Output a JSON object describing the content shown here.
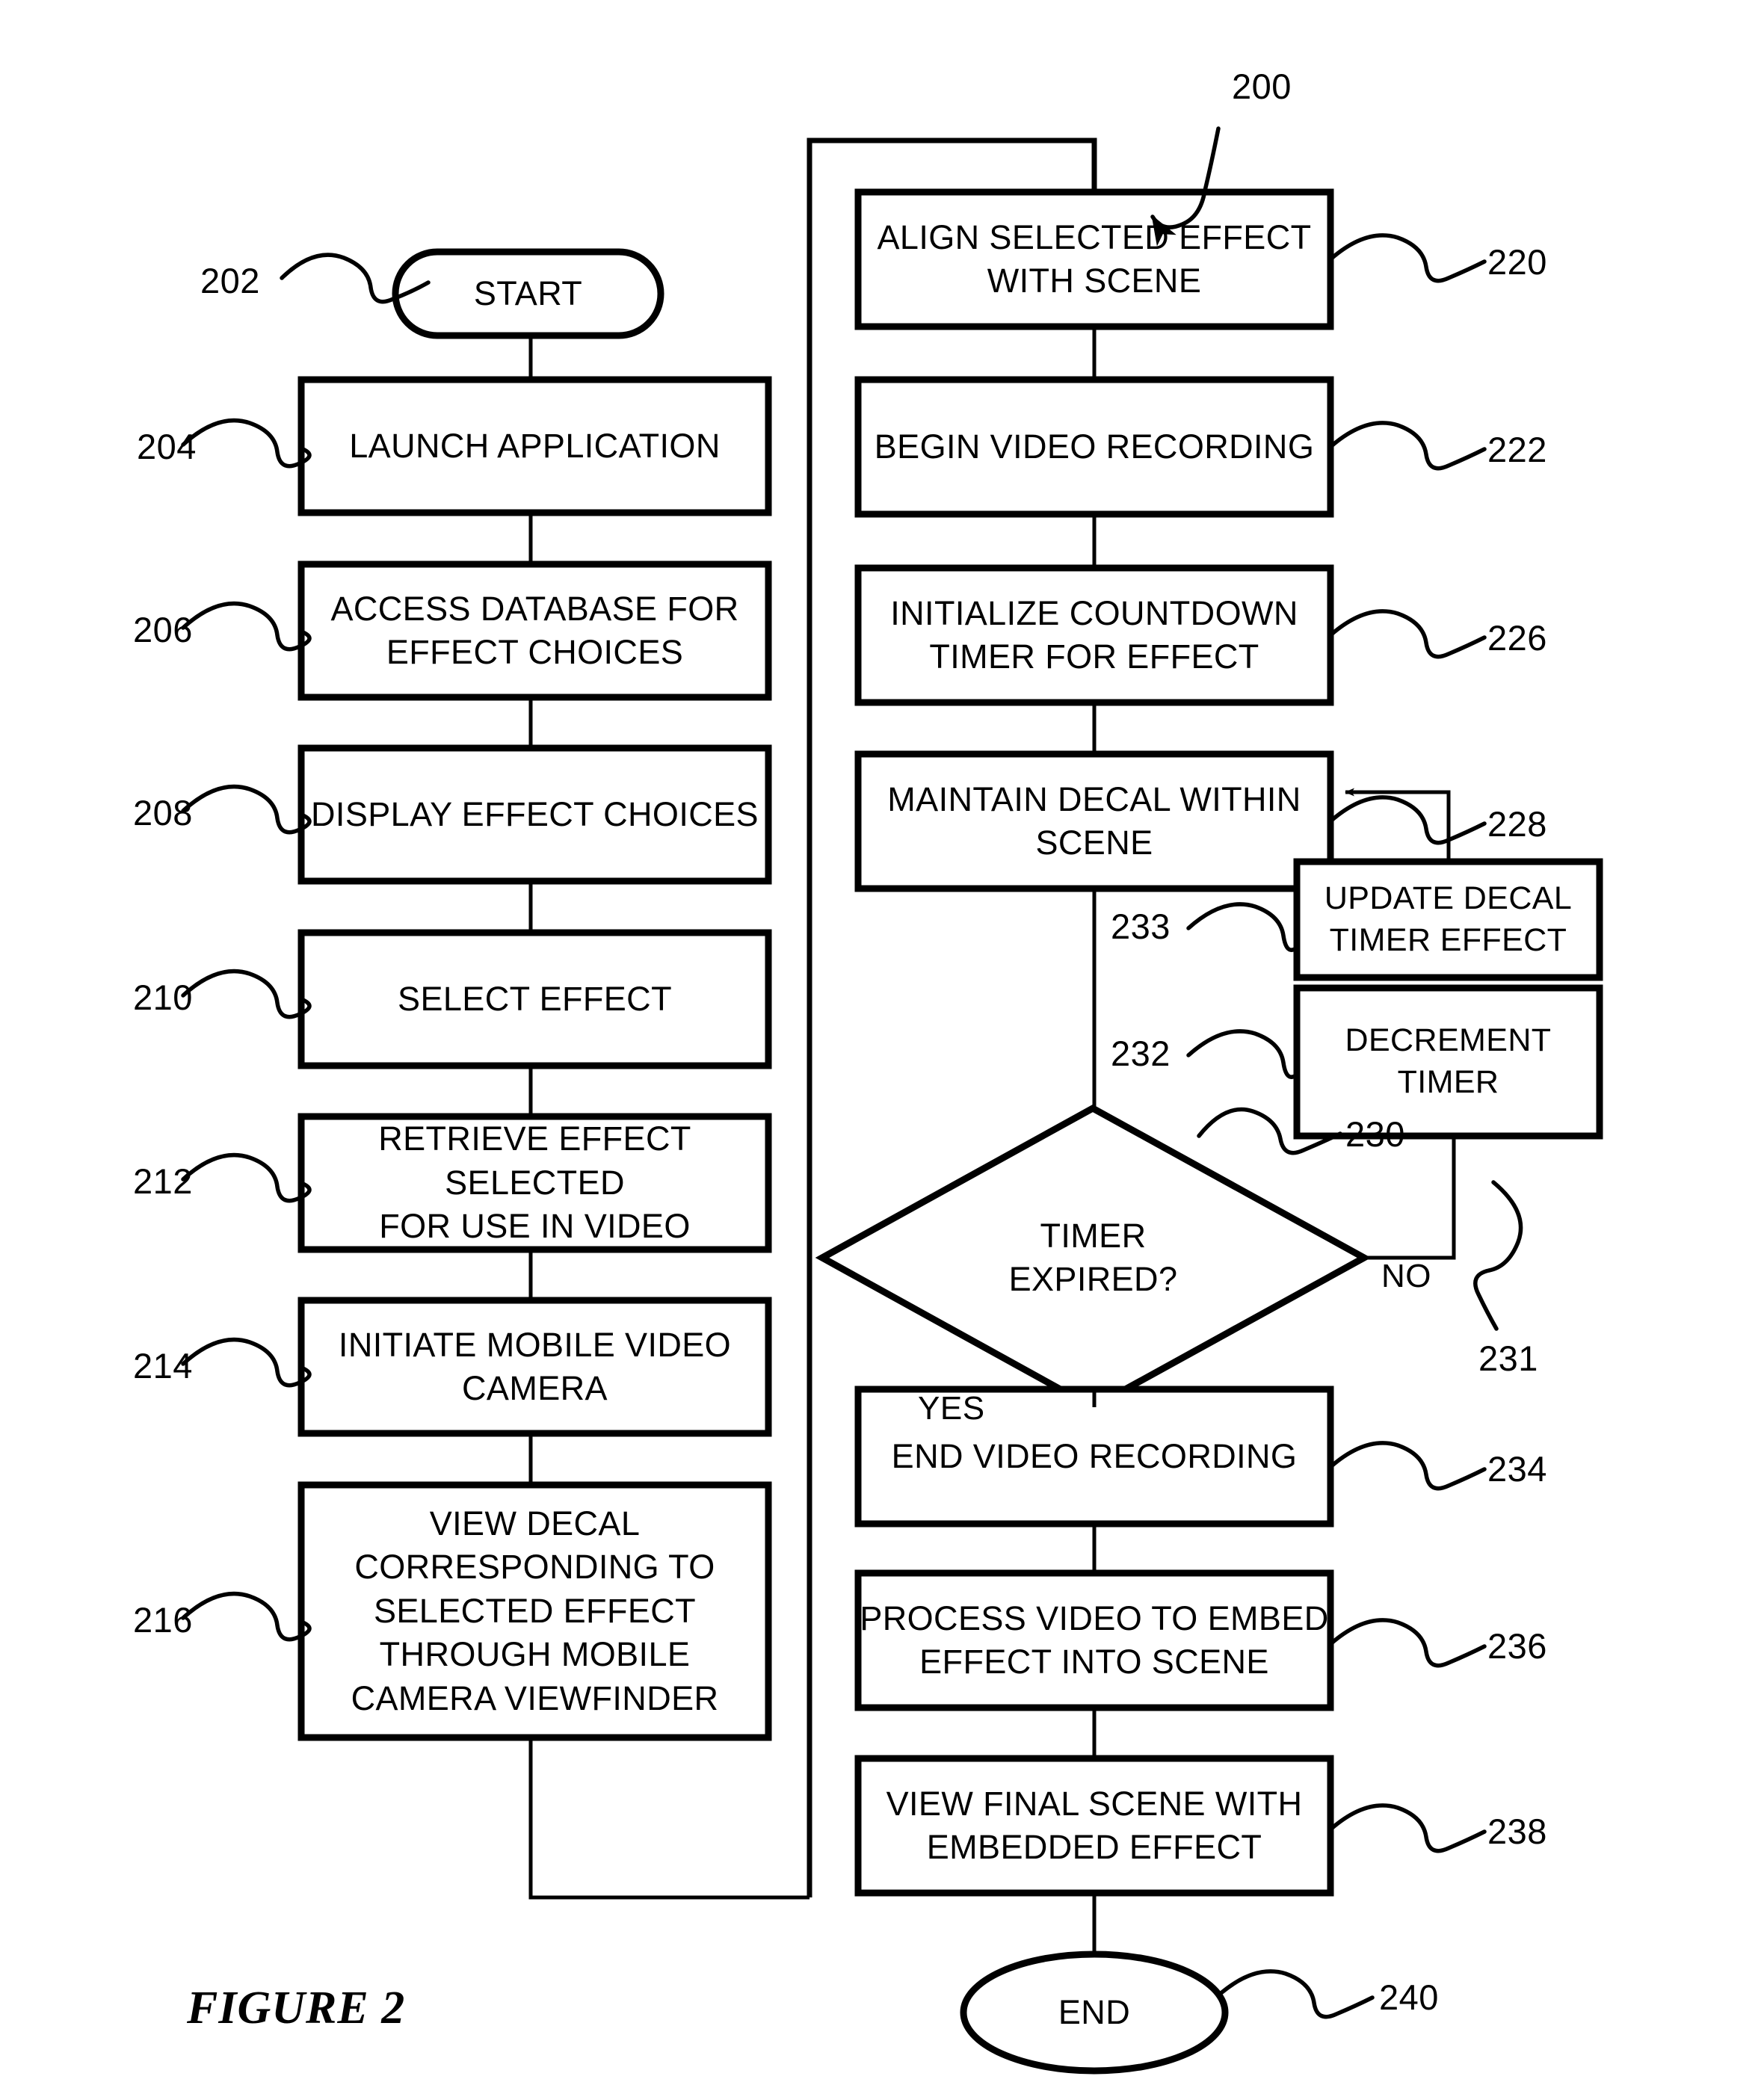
{
  "figure": {
    "caption": "FIGURE 2",
    "diagram_ref": "200"
  },
  "terminators": {
    "start": {
      "label": "START",
      "ref": "202"
    },
    "end": {
      "label": "END",
      "ref": "240"
    }
  },
  "left_column": [
    {
      "ref": "204",
      "text": "LAUNCH APPLICATION"
    },
    {
      "ref": "206",
      "text": "ACCESS DATABASE FOR\nEFFECT CHOICES"
    },
    {
      "ref": "208",
      "text": "DISPLAY EFFECT CHOICES"
    },
    {
      "ref": "210",
      "text": "SELECT EFFECT"
    },
    {
      "ref": "212",
      "text": "RETRIEVE EFFECT SELECTED\nFOR USE IN VIDEO"
    },
    {
      "ref": "214",
      "text": "INITIATE MOBILE VIDEO\nCAMERA"
    },
    {
      "ref": "216",
      "text": "VIEW DECAL\nCORRESPONDING TO\nSELECTED EFFECT\nTHROUGH MOBILE\nCAMERA VIEWFINDER"
    }
  ],
  "right_column": [
    {
      "ref": "220",
      "text": "ALIGN SELECTED EFFECT\nWITH SCENE"
    },
    {
      "ref": "222",
      "text": "BEGIN VIDEO RECORDING"
    },
    {
      "ref": "226",
      "text": "INITIALIZE COUNTDOWN\nTIMER FOR EFFECT"
    },
    {
      "ref": "228",
      "text": "MAINTAIN DECAL WITHIN\nSCENE"
    },
    {
      "ref": "234",
      "text": "END VIDEO RECORDING"
    },
    {
      "ref": "236",
      "text": "PROCESS VIDEO TO EMBED\nEFFECT INTO SCENE"
    },
    {
      "ref": "238",
      "text": "VIEW FINAL SCENE WITH\nEMBEDDED EFFECT"
    }
  ],
  "side_boxes": [
    {
      "ref": "233",
      "text": "UPDATE DECAL\nTIMER EFFECT"
    },
    {
      "ref": "232",
      "text": "DECREMENT\nTIMER"
    }
  ],
  "decision": {
    "ref": "230",
    "text": "TIMER\nEXPIRED?",
    "yes_label": "YES",
    "no_label": "NO",
    "no_branch_ref": "231"
  },
  "lines": {
    "line1_204": "LAUNCH APPLICATION",
    "line_206_a": "ACCESS DATABASE FOR",
    "line_206_b": "EFFECT CHOICES",
    "line_208": "DISPLAY EFFECT CHOICES",
    "line_210": "SELECT EFFECT",
    "line_212_a": "RETRIEVE EFFECT SELECTED",
    "line_212_b": "FOR USE IN VIDEO",
    "line_214_a": "INITIATE MOBILE VIDEO",
    "line_214_b": "CAMERA",
    "line_216_a": "VIEW DECAL",
    "line_216_b": "CORRESPONDING TO",
    "line_216_c": "SELECTED EFFECT",
    "line_216_d": "THROUGH MOBILE",
    "line_216_e": "CAMERA VIEWFINDER",
    "line_220_a": "ALIGN SELECTED EFFECT",
    "line_220_b": "WITH SCENE",
    "line_222": "BEGIN VIDEO RECORDING",
    "line_226_a": "INITIALIZE COUNTDOWN",
    "line_226_b": "TIMER FOR EFFECT",
    "line_228_a": "MAINTAIN DECAL WITHIN",
    "line_228_b": "SCENE",
    "line_233_a": "UPDATE DECAL",
    "line_233_b": "TIMER EFFECT",
    "line_232_a": "DECREMENT",
    "line_232_b": "TIMER",
    "line_230_a": "TIMER",
    "line_230_b": "EXPIRED?",
    "line_234": "END VIDEO RECORDING",
    "line_236_a": "PROCESS VIDEO TO EMBED",
    "line_236_b": "EFFECT INTO SCENE",
    "line_238_a": "VIEW FINAL SCENE WITH",
    "line_238_b": "EMBEDDED EFFECT"
  },
  "colors": {
    "ink": "#000000",
    "paper": "#ffffff"
  }
}
